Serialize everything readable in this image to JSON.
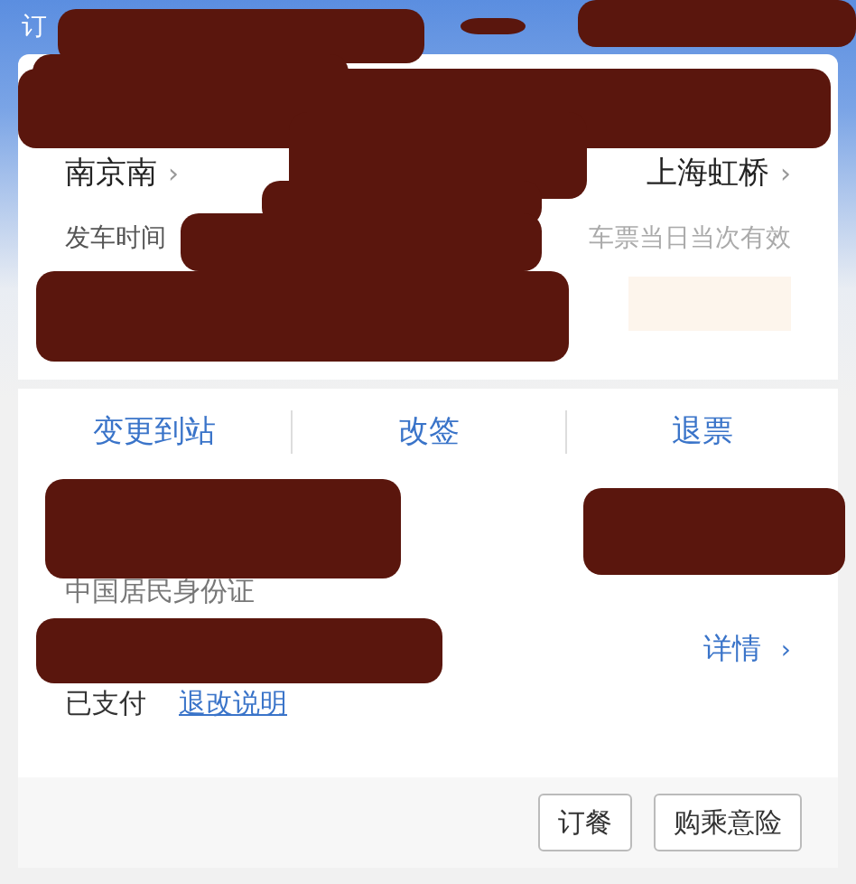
{
  "header": {
    "title": "订"
  },
  "route": {
    "from": "南京南",
    "from_chevron": "›",
    "to": "上海虹桥",
    "to_chevron": "›",
    "departure_label": "发车时间",
    "validity": "车票当日当次有效"
  },
  "actions": [
    {
      "label": "变更到站"
    },
    {
      "label": "改签"
    },
    {
      "label": "退票"
    }
  ],
  "passenger": {
    "id_type": "中国居民身份证",
    "details": "详情",
    "details_chevron": "›",
    "payment_status": "已支付",
    "refund_link": "退改说明"
  },
  "footer_buttons": [
    {
      "label": "订餐"
    },
    {
      "label": "购乘意险"
    }
  ]
}
